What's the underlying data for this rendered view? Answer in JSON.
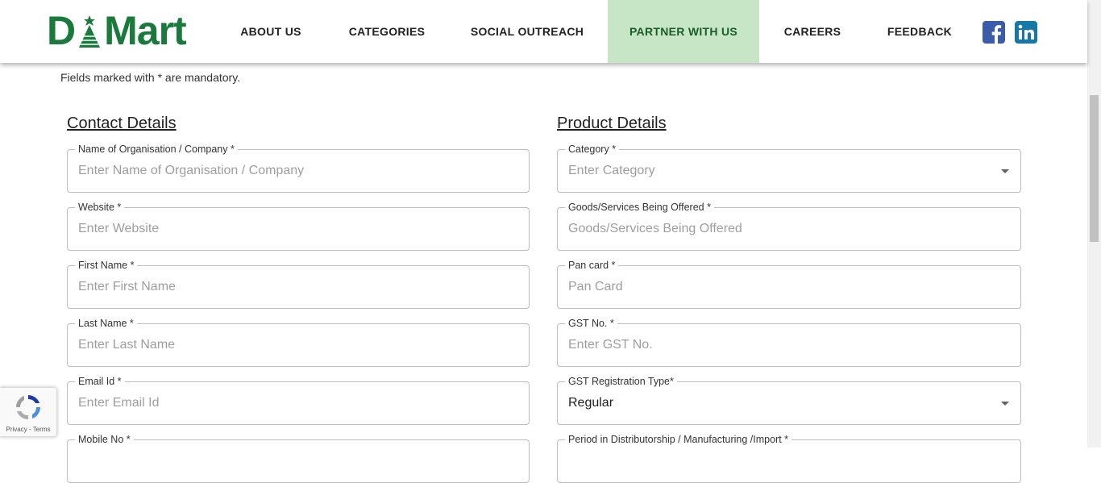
{
  "header": {
    "logo_left": "D",
    "logo_right": "Mart",
    "nav": [
      {
        "label": "ABOUT US"
      },
      {
        "label": "CATEGORIES"
      },
      {
        "label": "SOCIAL OUTREACH"
      },
      {
        "label": "PARTNER WITH US",
        "active": true
      },
      {
        "label": "CAREERS"
      },
      {
        "label": "FEEDBACK"
      }
    ],
    "social": [
      "facebook-icon",
      "linkedin-icon"
    ]
  },
  "form": {
    "mandatory_note": "Fields marked with * are mandatory.",
    "contact": {
      "title": "Contact Details",
      "fields": [
        {
          "label": "Name of Organisation / Company *",
          "placeholder": "Enter Name of Organisation / Company"
        },
        {
          "label": "Website *",
          "placeholder": "Enter Website"
        },
        {
          "label": "First Name *",
          "placeholder": "Enter First Name"
        },
        {
          "label": "Last Name *",
          "placeholder": "Enter Last Name"
        },
        {
          "label": "Email Id *",
          "placeholder": "Enter Email Id"
        },
        {
          "label": "Mobile No *",
          "placeholder": ""
        }
      ]
    },
    "product": {
      "title": "Product Details",
      "fields": [
        {
          "label": "Category *",
          "placeholder": "Enter Category"
        },
        {
          "label": "Goods/Services Being Offered *",
          "placeholder": "Goods/Services Being Offered"
        },
        {
          "label": "Pan card *",
          "placeholder": "Pan Card"
        },
        {
          "label": "GST No. *",
          "placeholder": "Enter GST No."
        },
        {
          "label": "GST Registration Type*",
          "value": "Regular"
        },
        {
          "label": "Period in Distributorship / Manufacturing /Import *",
          "placeholder": ""
        }
      ]
    }
  },
  "recaptcha": {
    "links": "Privacy - Terms"
  },
  "colors": {
    "brand_green": "#1a7a3c",
    "active_nav_bg": "#c7e6c6",
    "facebook": "#3b5ca8",
    "linkedin": "#1578a6"
  }
}
